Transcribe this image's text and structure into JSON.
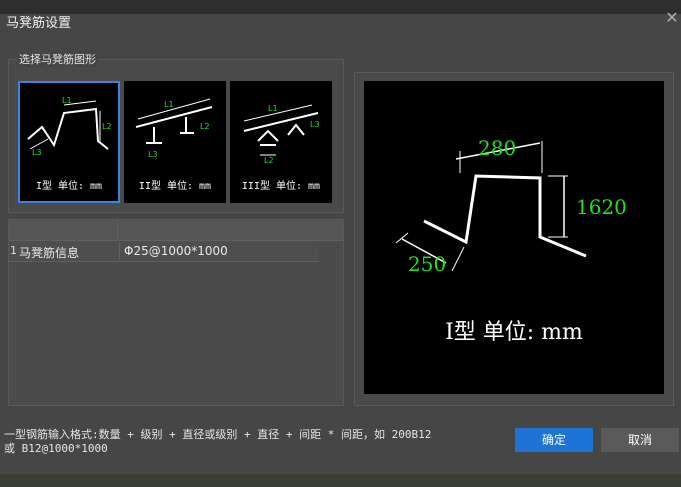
{
  "dialog": {
    "title": "马凳筋设置",
    "close_symbol": "✕"
  },
  "shape_group": {
    "label": "选择马凳筋图形",
    "options": [
      {
        "caption": "I型 单位: mm",
        "labels": [
          "L1",
          "L2",
          "L3"
        ],
        "selected": true
      },
      {
        "caption": "II型 单位: mm",
        "labels": [
          "L1",
          "L2",
          "L3"
        ],
        "selected": false
      },
      {
        "caption": "III型 单位: mm",
        "labels": [
          "L1",
          "L2",
          "L3"
        ],
        "selected": false
      }
    ]
  },
  "table": {
    "rows": [
      {
        "index": "1",
        "name": "马凳筋信息",
        "value": "Φ25@1000*1000"
      }
    ]
  },
  "preview": {
    "dim_top": "280",
    "dim_right": "1620",
    "dim_left": "250",
    "caption": "I型  单位: mm"
  },
  "hint": {
    "line1": "一型钢筋输入格式:数量 + 级别 + 直径或级别 + 直径 + 间距 * 间距，如 200B12",
    "line2": "或 B12@1000*1000"
  },
  "buttons": {
    "ok": "确定",
    "cancel": "取消"
  },
  "colors": {
    "accent": "#1f73d6",
    "dimension_text": "#22e022",
    "selection_border": "#3a85e0"
  }
}
